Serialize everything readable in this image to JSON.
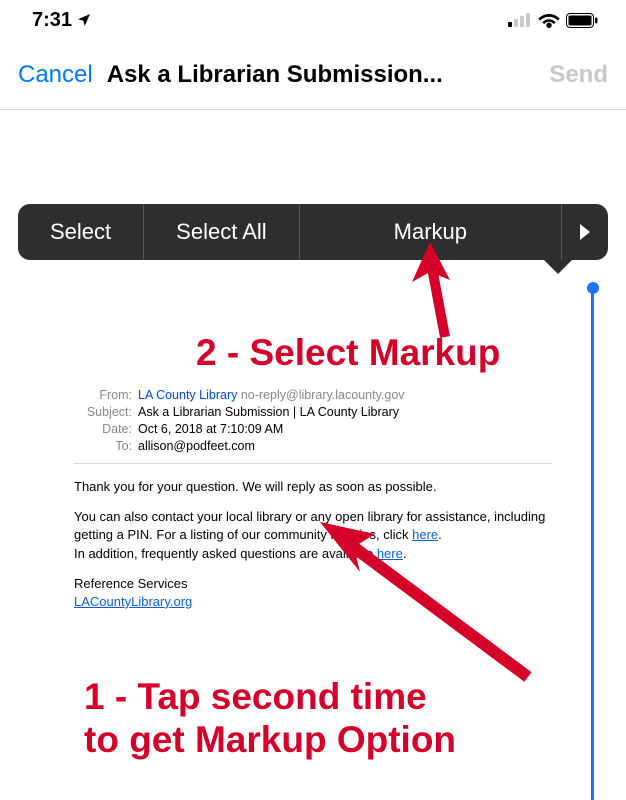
{
  "status": {
    "time": "7:31"
  },
  "nav": {
    "cancel": "Cancel",
    "title": "Ask a Librarian Submission...",
    "send": "Send"
  },
  "context_menu": {
    "select": "Select",
    "select_all": "Select All",
    "markup": "Markup",
    "more": "▶"
  },
  "annotations": {
    "step2": "2 - Select Markup",
    "step1_line1": "1 - Tap second time",
    "step1_line2": "to get Markup Option"
  },
  "email": {
    "labels": {
      "from": "From:",
      "subject": "Subject:",
      "date": "Date:",
      "to": "To:"
    },
    "from_name": "LA County Library",
    "from_email": "no-reply@library.lacounty.gov",
    "subject": "Ask a Librarian Submission | LA County Library",
    "date": "Oct 6, 2018 at 7:10:09 AM",
    "to": "allison@podfeet.com",
    "body": {
      "p1": "Thank you for your question. We will reply as soon as possible.",
      "p2a": "You can also contact your local library or any open library for assistance, including getting a PIN. For a listing of our community libraries, click ",
      "hereA": "here",
      "p2b": ".",
      "p3a": "In addition, frequently asked questions are available ",
      "hereB": "here",
      "p3b": ".",
      "sig1": "Reference Services",
      "sig2": "LACountyLibrary.org"
    }
  }
}
